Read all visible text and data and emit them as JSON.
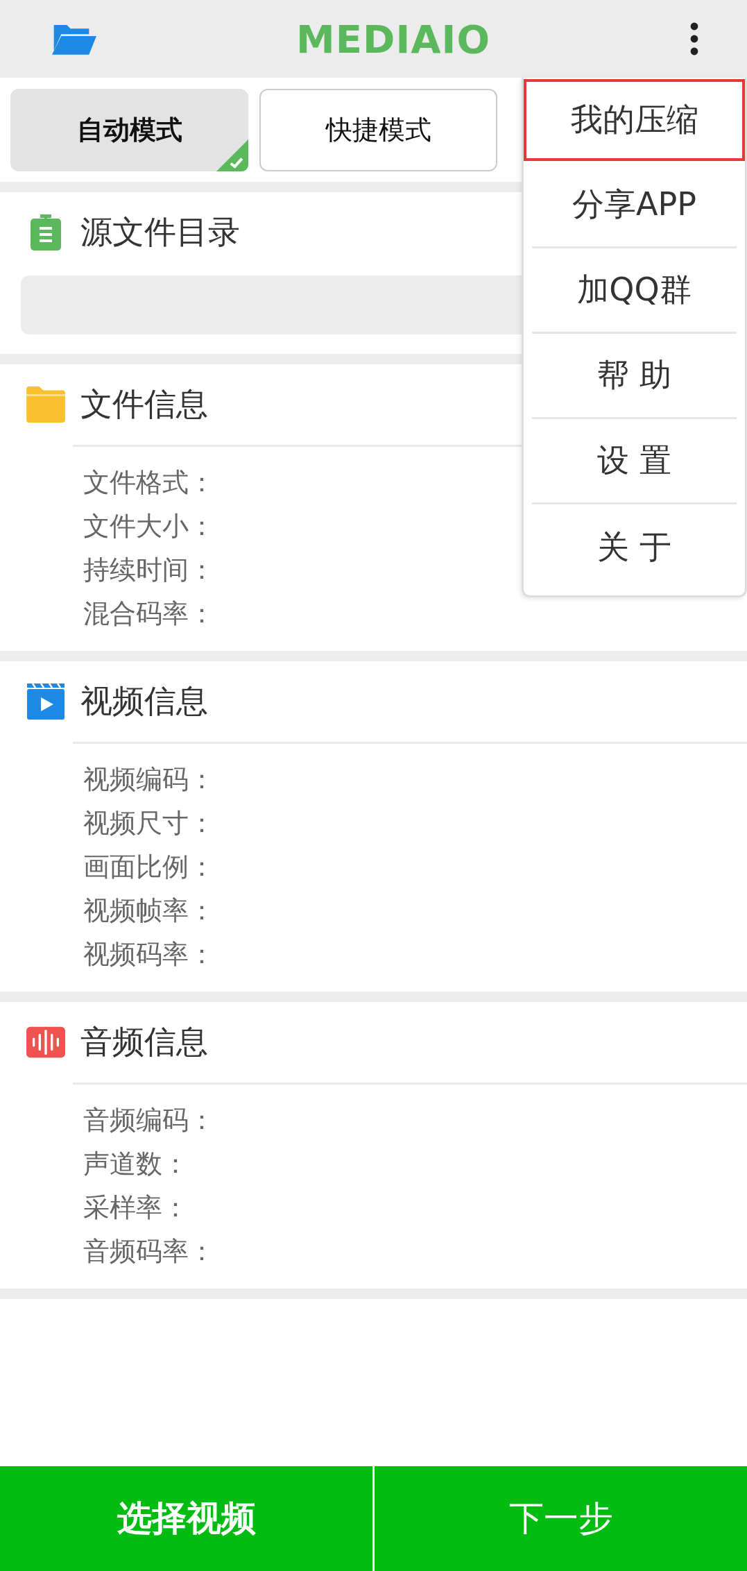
{
  "app_bar": {
    "logo": "MEDIAIO"
  },
  "tabs": [
    {
      "label": "自动模式",
      "selected": true
    },
    {
      "label": "快捷模式",
      "selected": false
    }
  ],
  "source": {
    "title": "源文件目录"
  },
  "sections": [
    {
      "kind": "file",
      "title": "文件信息",
      "fields": [
        "文件格式：",
        "文件大小：",
        "持续时间：",
        "混合码率："
      ]
    },
    {
      "kind": "video",
      "title": "视频信息",
      "fields": [
        "视频编码：",
        "视频尺寸：",
        "画面比例：",
        "视频帧率：",
        "视频码率："
      ]
    },
    {
      "kind": "audio",
      "title": "音频信息",
      "fields": [
        "音频编码：",
        "声道数：",
        "采样率：",
        "音频码率："
      ]
    }
  ],
  "menu": [
    {
      "label": "我的压缩",
      "selected": true
    },
    {
      "label": "分享APP",
      "selected": false
    },
    {
      "label": "加QQ群",
      "selected": false
    },
    {
      "label": "帮 助",
      "selected": false
    },
    {
      "label": "设 置",
      "selected": false
    },
    {
      "label": "关 于",
      "selected": false
    }
  ],
  "buttons": [
    {
      "label": "选择视频",
      "kind": "primary"
    },
    {
      "label": "下一步",
      "kind": "secondary"
    }
  ]
}
